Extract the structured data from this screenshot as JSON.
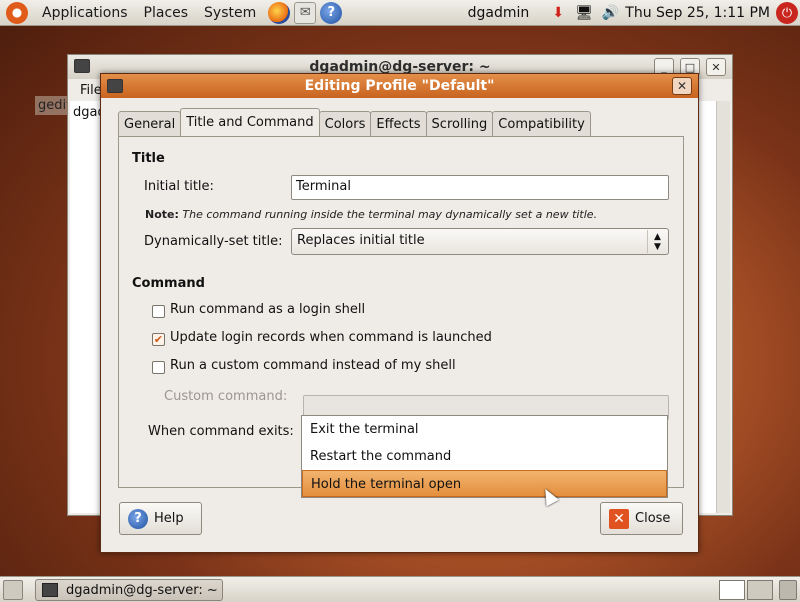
{
  "top_panel": {
    "menus": [
      "Applications",
      "Places",
      "System"
    ],
    "user": "dgadmin",
    "clock": "Thu Sep 25,  1:11 PM"
  },
  "background_window": {
    "title": "dgadmin@dg-server: ~",
    "menu_first": "File",
    "content_line": "dgad",
    "side_label": "gedit"
  },
  "dialog": {
    "title": "Editing Profile \"Default\"",
    "tabs": [
      {
        "label": "General"
      },
      {
        "label": "Title and Command"
      },
      {
        "label": "Colors"
      },
      {
        "label": "Effects"
      },
      {
        "label": "Scrolling"
      },
      {
        "label": "Compatibility"
      }
    ],
    "title_section": {
      "heading": "Title",
      "initial_title_label": "Initial title:",
      "initial_title_value": "Terminal",
      "note_bold": "Note:",
      "note_text": "The command running inside the terminal may dynamically set a new title.",
      "dynamic_label": "Dynamically-set title:",
      "dynamic_value": "Replaces initial title"
    },
    "command_section": {
      "heading": "Command",
      "login_shell": "Run command as a login shell",
      "update_records": "Update login records when command is launched",
      "custom_command_toggle": "Run a custom command instead of my shell",
      "custom_command_label": "Custom command:",
      "custom_command_value": "",
      "exits_label": "When command exits:",
      "exit_options": [
        "Exit the terminal",
        "Restart the command",
        "Hold the terminal open"
      ]
    },
    "buttons": {
      "help": "Help",
      "close": "Close"
    }
  },
  "bottom_panel": {
    "task": "dgadmin@dg-server: ~"
  },
  "colors": {
    "accent": "#e48f3e",
    "title_bar": "#c8631f"
  }
}
